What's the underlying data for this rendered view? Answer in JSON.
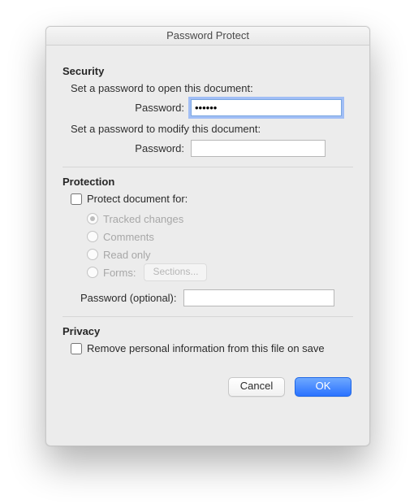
{
  "window": {
    "title": "Password Protect"
  },
  "security": {
    "heading": "Security",
    "open_instruction": "Set a password to open this document:",
    "open_pw_label": "Password:",
    "open_pw_value": "••••••",
    "modify_instruction": "Set a password to modify this document:",
    "modify_pw_label": "Password:",
    "modify_pw_value": ""
  },
  "protection": {
    "heading": "Protection",
    "protect_for_label": "Protect document for:",
    "options": {
      "tracked": "Tracked changes",
      "comments": "Comments",
      "readonly": "Read only",
      "forms": "Forms:",
      "sections_btn": "Sections..."
    },
    "optional_pw_label": "Password (optional):",
    "optional_pw_value": ""
  },
  "privacy": {
    "heading": "Privacy",
    "remove_pii_label": "Remove personal information from this file on save"
  },
  "buttons": {
    "cancel": "Cancel",
    "ok": "OK"
  }
}
